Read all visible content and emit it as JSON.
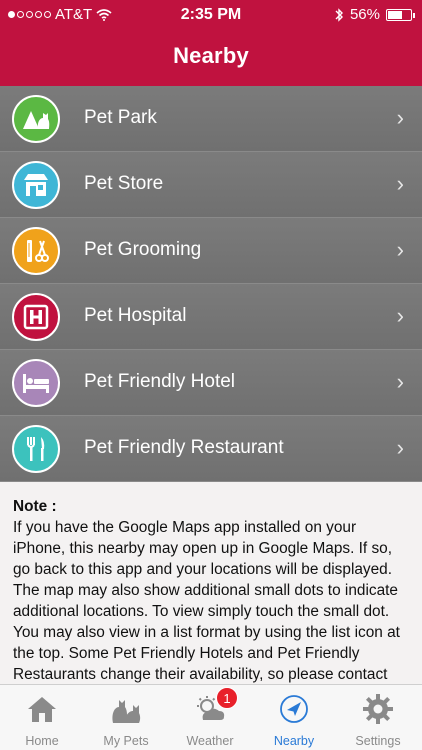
{
  "status": {
    "carrier": "AT&T",
    "time": "2:35 PM",
    "battery": "56%"
  },
  "nav": {
    "title": "Nearby"
  },
  "list": [
    {
      "label": "Pet Park",
      "icon": "dog-park-icon",
      "color": "#5bb843"
    },
    {
      "label": "Pet Store",
      "icon": "storefront-icon",
      "color": "#3fb6d6"
    },
    {
      "label": "Pet Grooming",
      "icon": "grooming-icon",
      "color": "#f0a21b"
    },
    {
      "label": "Pet Hospital",
      "icon": "hospital-icon",
      "color": "#c0123f"
    },
    {
      "label": "Pet Friendly Hotel",
      "icon": "bed-icon",
      "color": "#a886b8"
    },
    {
      "label": "Pet Friendly Restaurant",
      "icon": "fork-knife-icon",
      "color": "#3cc2bd"
    }
  ],
  "note": {
    "title": "Note :",
    "body": "If you have the Google Maps app installed on your iPhone, this nearby may open up in Google Maps. If so, go back to this app and your locations will be displayed. The map may also show additional small dots to indicate additional locations. To view simply touch the small dot. You may also view in a list format by using the list icon at the top. Some Pet Friendly Hotels and Pet Friendly Restaurants change their availability, so please contact them directly to ensure"
  },
  "tabs": [
    {
      "label": "Home",
      "icon": "house-icon"
    },
    {
      "label": "My Pets",
      "icon": "pets-icon"
    },
    {
      "label": "Weather",
      "icon": "weather-icon",
      "badge": "1"
    },
    {
      "label": "Nearby",
      "icon": "location-arrow-icon"
    },
    {
      "label": "Settings",
      "icon": "gear-icon"
    }
  ],
  "colors": {
    "brand": "#c0123f",
    "active_tab": "#2a7ad6"
  }
}
